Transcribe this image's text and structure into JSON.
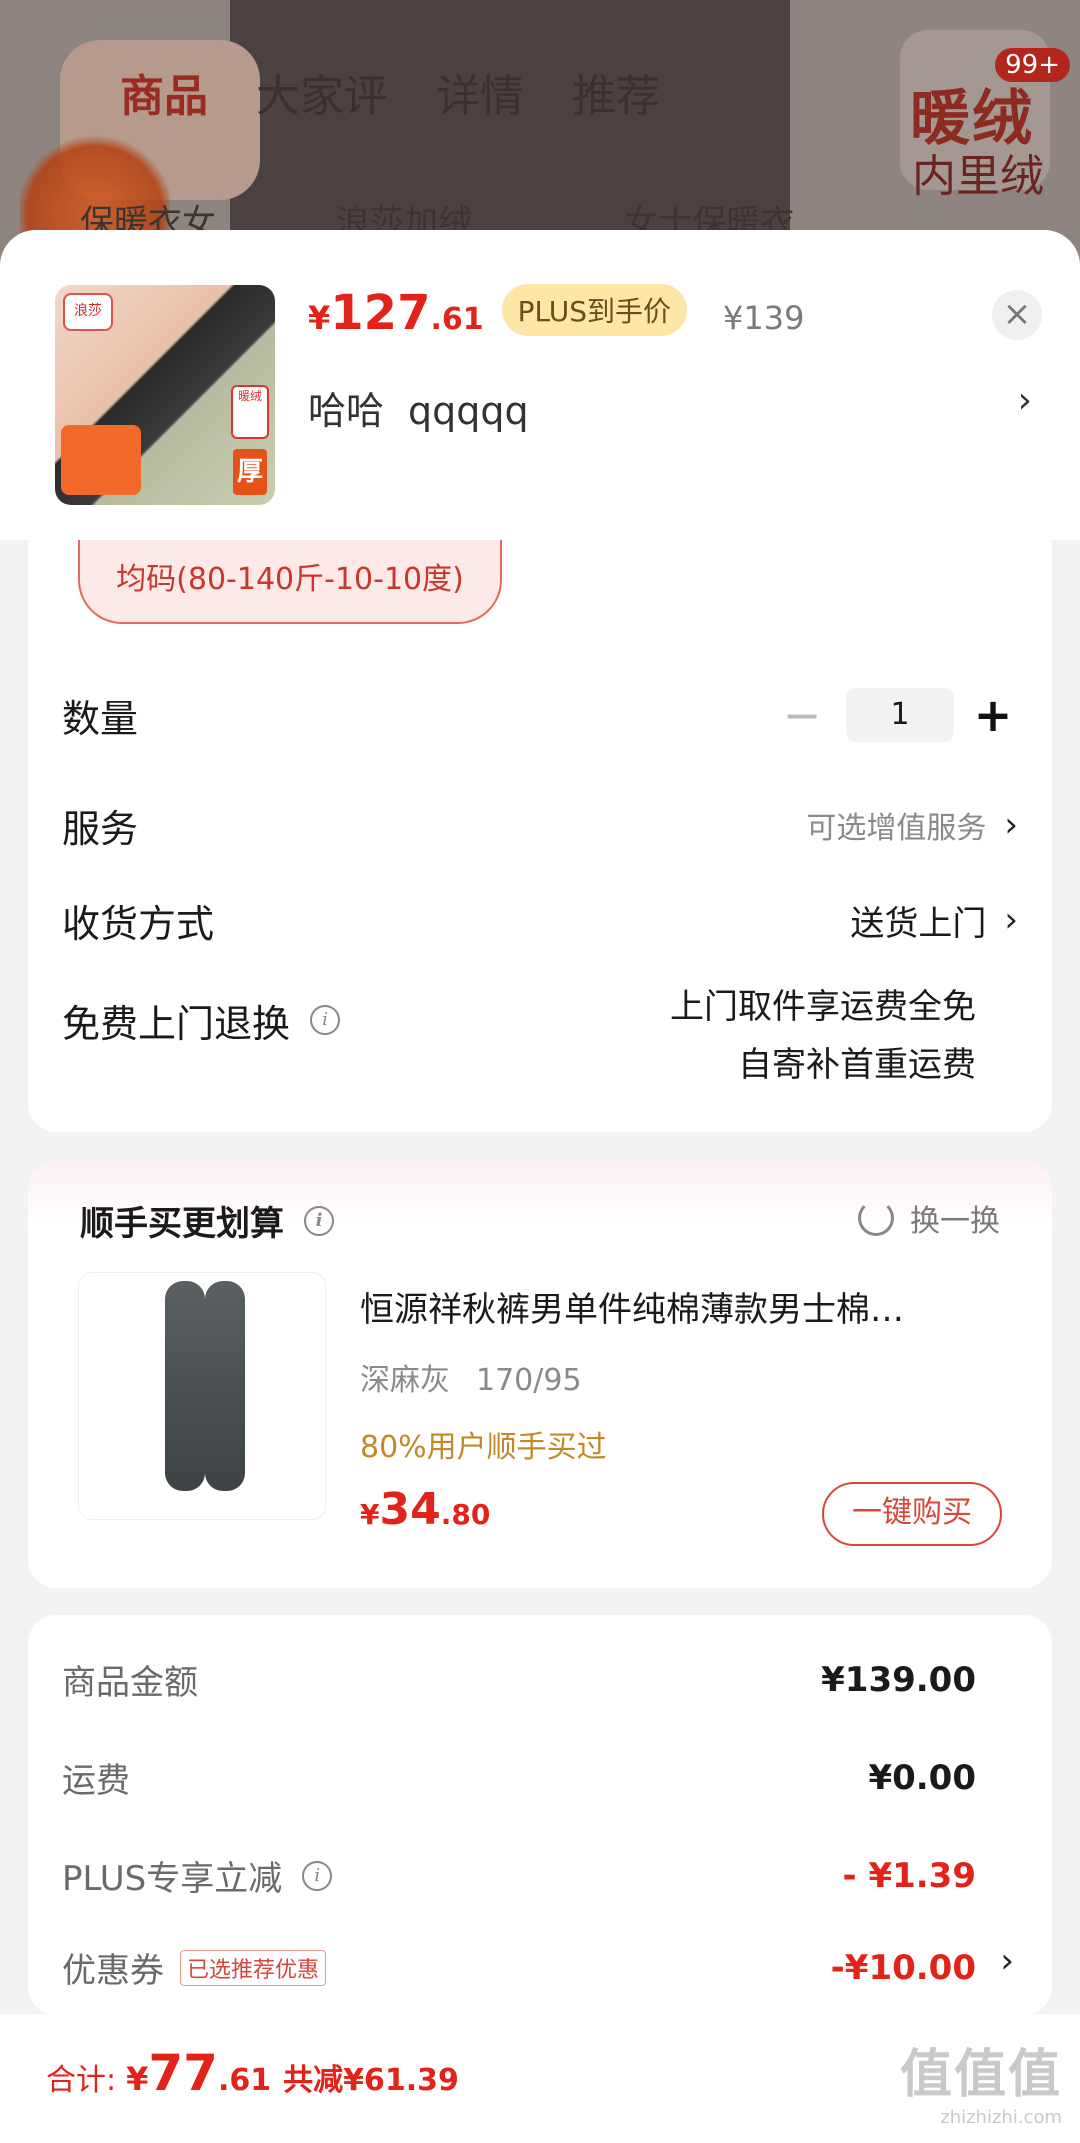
{
  "background": {
    "tabs": [
      "商品",
      "大家评",
      "详情",
      "推荐"
    ],
    "active_tab": "商品",
    "suggestions": [
      "保暖衣女",
      "浪莎加绒...",
      "女士保暖衣"
    ],
    "badge_line1": "暖绒",
    "badge_line2": "内里绒",
    "cart_count": "99+"
  },
  "product": {
    "currency": "¥",
    "price_int": "127",
    "price_dec": ".61",
    "plus_badge": "PLUS到手价",
    "original_price": "¥139",
    "variant_name": "哈哈",
    "variant_detail": "qqqqq",
    "image_brand_tag": "浪莎",
    "image_thick_label": "厚",
    "image_warm_label": "暖绒"
  },
  "options": {
    "size_chip": "均码(80-140斤-10-10度)",
    "quantity_label": "数量",
    "quantity_value": "1",
    "service_label": "服务",
    "service_value": "可选增值服务",
    "delivery_label": "收货方式",
    "delivery_value": "送货上门",
    "return_label": "免费上门退换",
    "return_line1": "上门取件享运费全免",
    "return_line2": "自寄补首重运费"
  },
  "upsell": {
    "title": "顺手买更划算",
    "swap_label": "换一换",
    "item_name": "恒源祥秋裤男单件纯棉薄款男士棉…",
    "item_color": "深麻灰",
    "item_size": "170/95",
    "social_proof": "80%用户顺手买过",
    "price_currency": "¥",
    "price_int": "34",
    "price_dec": ".80",
    "buy_button": "一键购买"
  },
  "summary": {
    "goods_label": "商品金额",
    "goods_value": "¥139.00",
    "shipping_label": "运费",
    "shipping_value": "¥0.00",
    "plus_label": "PLUS专享立减",
    "plus_value": "- ¥1.39",
    "coupon_label": "优惠券",
    "coupon_tag": "已选推荐优惠",
    "coupon_value": "-¥10.00"
  },
  "footer": {
    "total_label": "合计:",
    "currency": "¥",
    "total_int": "77",
    "total_dec": ".61",
    "saved": "共减¥61.39",
    "watermark_big": "值值值",
    "watermark_small": "zhizhizhi.com"
  },
  "colors": {
    "price_red": "#e2231a",
    "plus_badge_bg": "#fde6a6",
    "social_gold": "#c08a2a"
  }
}
